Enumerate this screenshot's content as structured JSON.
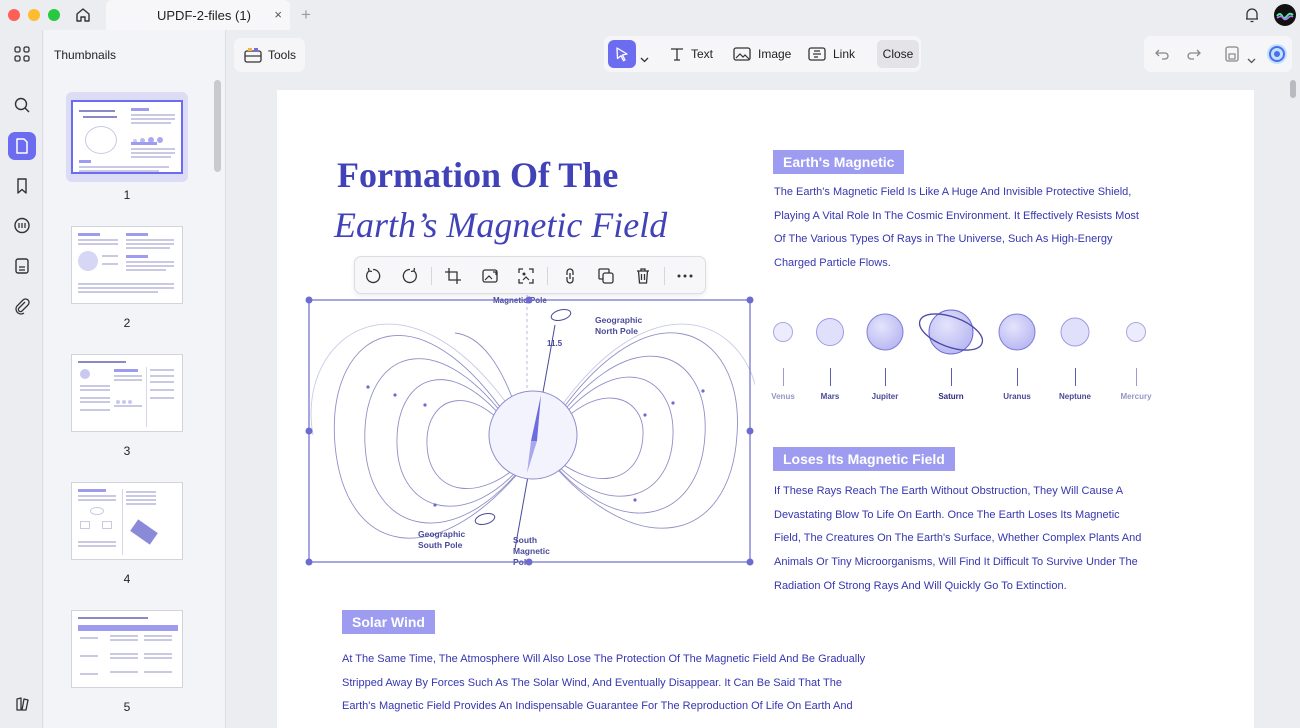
{
  "window": {
    "tab_title": "UPDF-2-files (1)",
    "tab_close": "×",
    "tab_add": "+"
  },
  "sidebar": {
    "title": "Thumbnails",
    "items": [
      {
        "icon": "grid-icon"
      },
      {
        "icon": "search-icon"
      },
      {
        "icon": "page-icon",
        "active": true
      },
      {
        "icon": "bookmark-icon"
      },
      {
        "icon": "comment-icon"
      },
      {
        "icon": "forms-icon"
      },
      {
        "icon": "paperclip-icon"
      }
    ],
    "bottom_icon": "layers-icon"
  },
  "thumbnails": [
    {
      "number": "1",
      "selected": true
    },
    {
      "number": "2"
    },
    {
      "number": "3"
    },
    {
      "number": "4"
    },
    {
      "number": "5"
    }
  ],
  "toolbar": {
    "tools_label": "Tools",
    "text_label": "Text",
    "image_label": "Image",
    "link_label": "Link",
    "close_label": "Close"
  },
  "document": {
    "title_line1": "Formation Of The",
    "title_line2": "Earth’s Magnetic Field",
    "section1": {
      "heading": "Earth's Magnetic",
      "lines": [
        "The Earth's Magnetic Field Is Like A Huge And Invisible Protective Shield,",
        "Playing A Vital Role In The Cosmic Environment. It Effectively Resists Most",
        "Of The Various Types Of Rays in The Universe, Such As High-Energy",
        "Charged Particle Flows."
      ]
    },
    "planets": [
      "Venus",
      "Mars",
      "Jupiter",
      "Saturn",
      "Uranus",
      "Neptune",
      "Mercury"
    ],
    "section2": {
      "heading": "Loses Its Magnetic Field",
      "lines": [
        "If These Rays Reach The Earth Without Obstruction, They Will Cause A",
        "Devastating Blow To Life On Earth. Once The Earth Loses Its Magnetic",
        "Field, The Creatures On The Earth's Surface, Whether Complex Plants And",
        "Animals Or Tiny Microorganisms, Will Find It Difficult To Survive Under The",
        "Radiation Of Strong Rays And Will Quickly Go To Extinction."
      ]
    },
    "section3": {
      "heading": "Solar Wind",
      "lines": [
        "At The Same Time, The Atmosphere Will Also Lose The Protection Of The Magnetic Field And Be Gradually",
        "Stripped Away By Forces Such As The Solar Wind, And Eventually Disappear. It Can Be Said That The",
        "Earth's Magnetic Field Provides An Indispensable Guarantee For The Reproduction Of Life On Earth And"
      ]
    },
    "diagram": {
      "magnetic_pole": "Magnetic Pole",
      "geo_north": [
        "Geographic",
        "North Pole"
      ],
      "angle": "11.5",
      "geo_south": [
        "Geographic",
        "South Pole"
      ],
      "mag_south": [
        "South",
        "Magnetic",
        "Pole"
      ]
    }
  },
  "colors": {
    "accent": "#6c6cf0",
    "text_blue": "#3636b0",
    "tag_bg": "#9d9cf0"
  }
}
